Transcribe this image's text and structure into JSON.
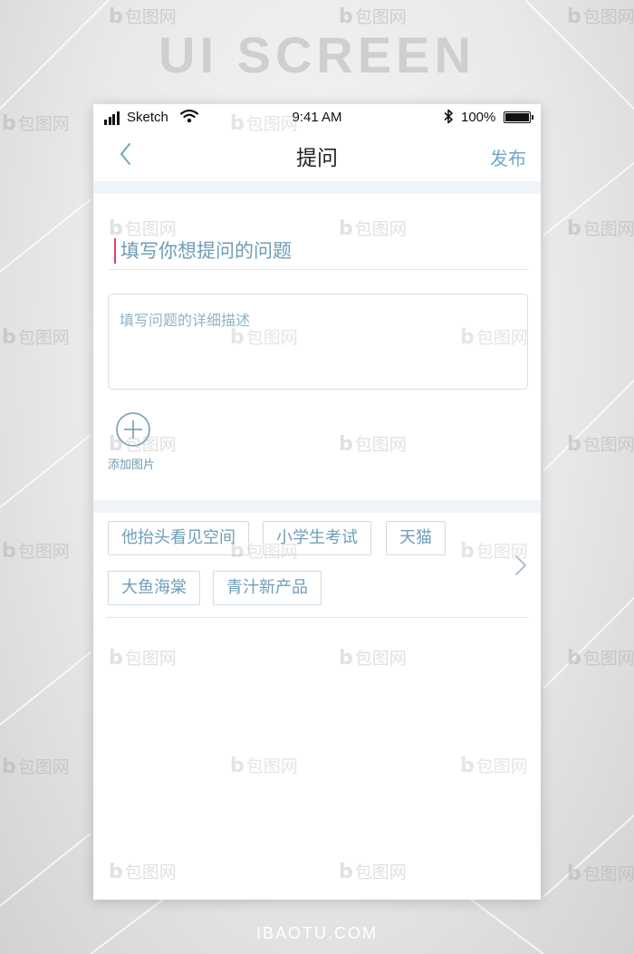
{
  "background": {
    "headline": "UI SCREEN",
    "footer": "IBAOTU.COM",
    "watermark_text": "包图网",
    "watermark_mark": "b"
  },
  "status_bar": {
    "carrier": "Sketch",
    "time": "9:41 AM",
    "battery_percent": "100%",
    "signal_bars": 4,
    "icons": [
      "signal-icon",
      "wifi-icon",
      "bluetooth-icon",
      "battery-icon"
    ]
  },
  "navbar": {
    "back_icon": "chevron-left-icon",
    "title": "提问",
    "publish_label": "发布"
  },
  "form": {
    "title_placeholder": "填写你想提问的问题",
    "description_placeholder": "填写问题的详细描述",
    "add_image_label": "添加图片",
    "add_image_icon": "plus-circle-icon"
  },
  "tags": [
    "他抬头看见空间",
    "小学生考试",
    "天猫",
    "大鱼海棠",
    "青汁新产品"
  ],
  "more_tags_icon": "chevron-right-icon",
  "colors": {
    "accent": "#6fa7c6",
    "placeholder": "#8fb3c6",
    "cursor": "#e0436a",
    "section_band": "#eef4f8",
    "border": "#d6dee3"
  }
}
